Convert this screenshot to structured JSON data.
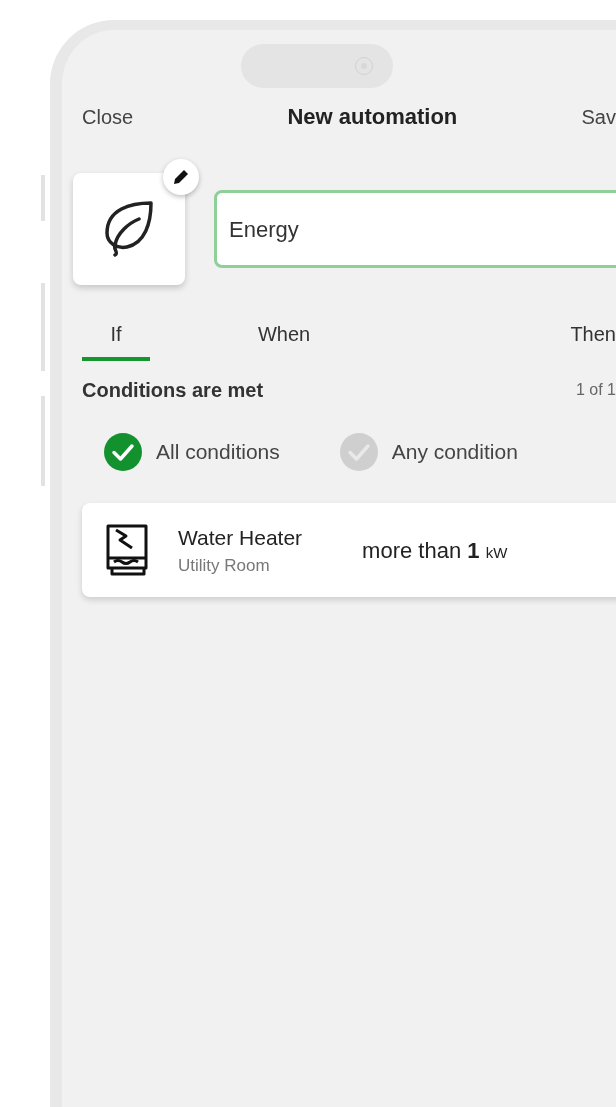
{
  "header": {
    "close": "Close",
    "title": "New automation",
    "save": "Sav"
  },
  "name_field": {
    "value": "Energy"
  },
  "tabs": [
    {
      "label": "If",
      "selected": true
    },
    {
      "label": "When",
      "selected": false
    },
    {
      "label": "Then",
      "selected": false
    }
  ],
  "conditions": {
    "title": "Conditions are met",
    "count": "1 of 1"
  },
  "modes": [
    {
      "label": "All conditions",
      "selected": true
    },
    {
      "label": "Any condition",
      "selected": false
    }
  ],
  "rules": [
    {
      "device": "Water Heater",
      "room": "Utility Room",
      "comparison": "more than",
      "value": "1",
      "unit": "kW"
    }
  ]
}
